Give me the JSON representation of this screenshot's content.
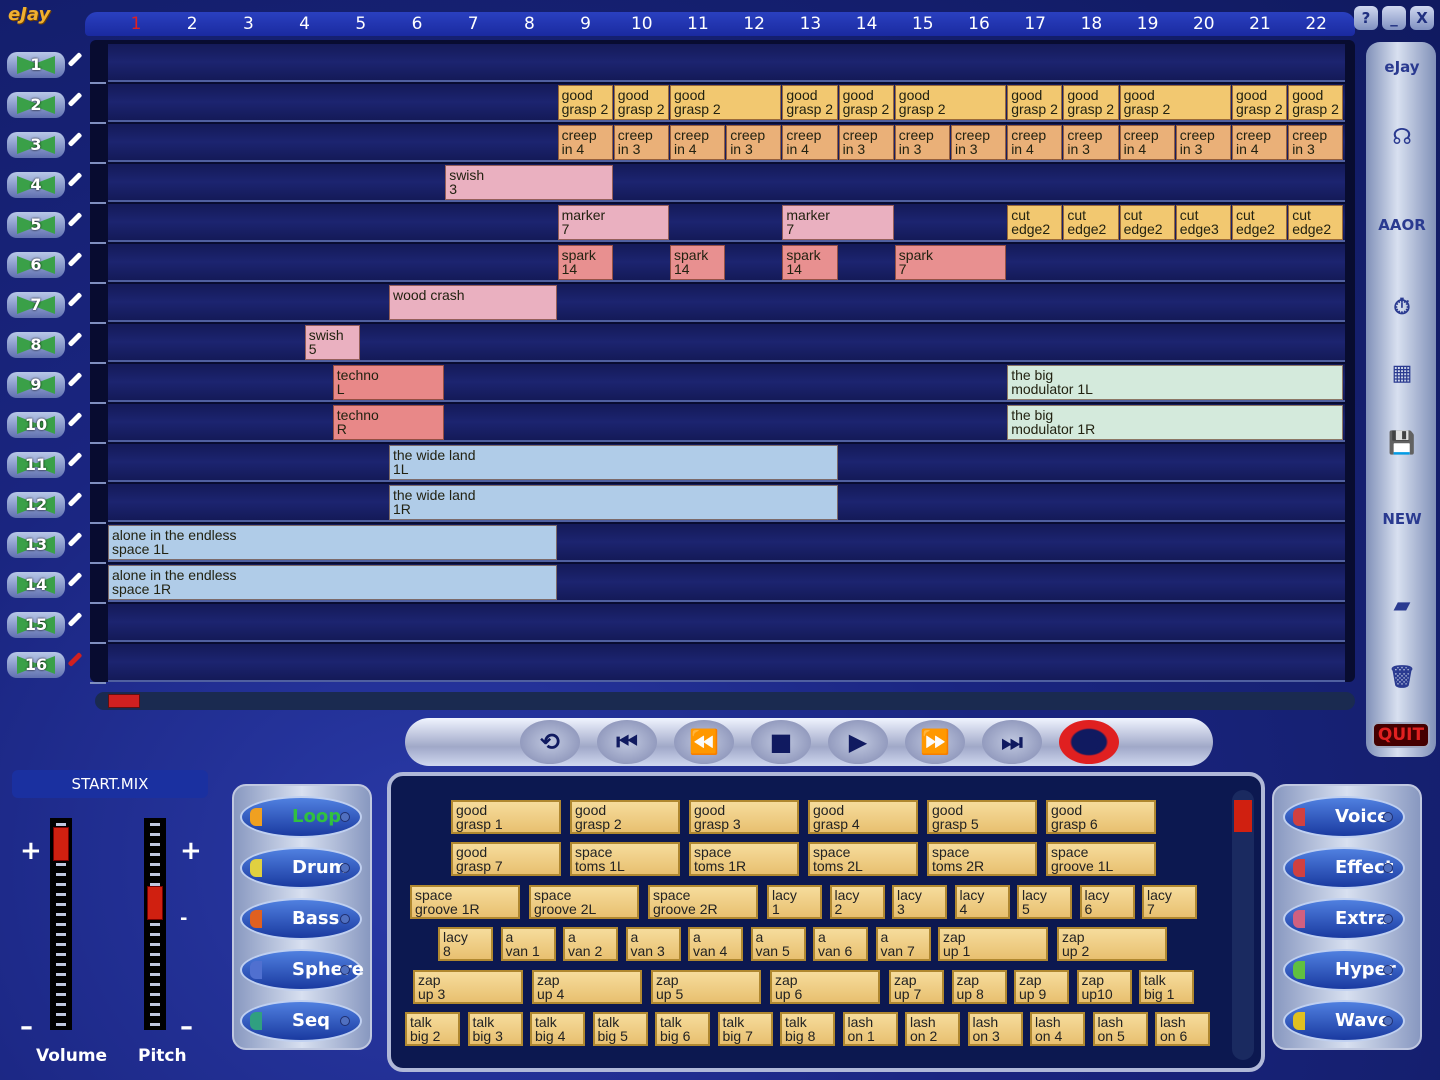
{
  "app": {
    "logo": "eJay"
  },
  "window_buttons": [
    "?",
    "_",
    "X"
  ],
  "ruler": {
    "bars": [
      "1",
      "2",
      "3",
      "4",
      "5",
      "6",
      "7",
      "8",
      "9",
      "10",
      "11",
      "12",
      "13",
      "14",
      "15",
      "16",
      "17",
      "18",
      "19",
      "20",
      "21",
      "22"
    ],
    "current_bar": "1",
    "current_color": "#e02020"
  },
  "tracks": [
    "1",
    "2",
    "3",
    "4",
    "5",
    "6",
    "7",
    "8",
    "9",
    "10",
    "11",
    "12",
    "13",
    "14",
    "15",
    "16"
  ],
  "active_track": "16",
  "clips": [
    {
      "track": 2,
      "start": 9,
      "length": 1,
      "label": "good\ngrasp 2",
      "color": "#f2c870"
    },
    {
      "track": 2,
      "start": 10,
      "length": 1,
      "label": "good\ngrasp 2",
      "color": "#f2c870"
    },
    {
      "track": 2,
      "start": 11,
      "length": 2,
      "label": "good\ngrasp 2",
      "color": "#f2c870"
    },
    {
      "track": 2,
      "start": 13,
      "length": 1,
      "label": "good\ngrasp 2",
      "color": "#f2c870"
    },
    {
      "track": 2,
      "start": 14,
      "length": 1,
      "label": "good\ngrasp 2",
      "color": "#f2c870"
    },
    {
      "track": 2,
      "start": 15,
      "length": 2,
      "label": "good\ngrasp 2",
      "color": "#f2c870"
    },
    {
      "track": 2,
      "start": 17,
      "length": 1,
      "label": "good\ngrasp 2",
      "color": "#f2c870"
    },
    {
      "track": 2,
      "start": 18,
      "length": 1,
      "label": "good\ngrasp 2",
      "color": "#f2c870"
    },
    {
      "track": 2,
      "start": 19,
      "length": 2,
      "label": "good\ngrasp 2",
      "color": "#f2c870"
    },
    {
      "track": 2,
      "start": 21,
      "length": 1,
      "label": "good\ngrasp 2",
      "color": "#f2c870"
    },
    {
      "track": 2,
      "start": 22,
      "length": 1,
      "label": "good\ngrasp 2",
      "color": "#f2c870"
    },
    {
      "track": 3,
      "start": 9,
      "length": 1,
      "label": "creep\nin 4",
      "color": "#eab078"
    },
    {
      "track": 3,
      "start": 10,
      "length": 1,
      "label": "creep\nin 3",
      "color": "#eab078"
    },
    {
      "track": 3,
      "start": 11,
      "length": 1,
      "label": "creep\nin 4",
      "color": "#eab078"
    },
    {
      "track": 3,
      "start": 12,
      "length": 1,
      "label": "creep\nin 3",
      "color": "#eab078"
    },
    {
      "track": 3,
      "start": 13,
      "length": 1,
      "label": "creep\nin 4",
      "color": "#eab078"
    },
    {
      "track": 3,
      "start": 14,
      "length": 1,
      "label": "creep\nin 3",
      "color": "#eab078"
    },
    {
      "track": 3,
      "start": 15,
      "length": 1,
      "label": "creep\nin 3",
      "color": "#eab078"
    },
    {
      "track": 3,
      "start": 16,
      "length": 1,
      "label": "creep\nin 3",
      "color": "#eab078"
    },
    {
      "track": 3,
      "start": 17,
      "length": 1,
      "label": "creep\nin 4",
      "color": "#eab078"
    },
    {
      "track": 3,
      "start": 18,
      "length": 1,
      "label": "creep\nin 3",
      "color": "#eab078"
    },
    {
      "track": 3,
      "start": 19,
      "length": 1,
      "label": "creep\nin 4",
      "color": "#eab078"
    },
    {
      "track": 3,
      "start": 20,
      "length": 1,
      "label": "creep\nin 3",
      "color": "#eab078"
    },
    {
      "track": 3,
      "start": 21,
      "length": 1,
      "label": "creep\nin 4",
      "color": "#eab078"
    },
    {
      "track": 3,
      "start": 22,
      "length": 1,
      "label": "creep\nin 3",
      "color": "#eab078"
    },
    {
      "track": 4,
      "start": 7,
      "length": 3,
      "label": "swish\n3",
      "color": "#eab0c0"
    },
    {
      "track": 5,
      "start": 9,
      "length": 2,
      "label": "marker\n7",
      "color": "#eab0c0"
    },
    {
      "track": 5,
      "start": 13,
      "length": 2,
      "label": "marker\n7",
      "color": "#eab0c0"
    },
    {
      "track": 5,
      "start": 17,
      "length": 1,
      "label": "cut\nedge2",
      "color": "#f2c870"
    },
    {
      "track": 5,
      "start": 18,
      "length": 1,
      "label": "cut\nedge2",
      "color": "#f2c870"
    },
    {
      "track": 5,
      "start": 19,
      "length": 1,
      "label": "cut\nedge2",
      "color": "#f2c870"
    },
    {
      "track": 5,
      "start": 20,
      "length": 1,
      "label": "cut\nedge3",
      "color": "#f2c870"
    },
    {
      "track": 5,
      "start": 21,
      "length": 1,
      "label": "cut\nedge2",
      "color": "#f2c870"
    },
    {
      "track": 5,
      "start": 22,
      "length": 1,
      "label": "cut\nedge2",
      "color": "#f2c870"
    },
    {
      "track": 6,
      "start": 9,
      "length": 1,
      "label": "spark\n14",
      "color": "#e89090"
    },
    {
      "track": 6,
      "start": 11,
      "length": 1,
      "label": "spark\n14",
      "color": "#e89090"
    },
    {
      "track": 6,
      "start": 13,
      "length": 1,
      "label": "spark\n14",
      "color": "#e89090"
    },
    {
      "track": 6,
      "start": 15,
      "length": 2,
      "label": "spark\n7",
      "color": "#e89090"
    },
    {
      "track": 7,
      "start": 6,
      "length": 3,
      "label": "wood crash",
      "color": "#eab0c0"
    },
    {
      "track": 8,
      "start": 4.5,
      "length": 1,
      "label": "swish\n5",
      "color": "#eab0c0"
    },
    {
      "track": 9,
      "start": 5,
      "length": 2,
      "label": "techno\nL",
      "color": "#e88888"
    },
    {
      "track": 9,
      "start": 17,
      "length": 6,
      "label": "the big\nmodulator 1L",
      "color": "#d4eadc"
    },
    {
      "track": 10,
      "start": 5,
      "length": 2,
      "label": "techno\nR",
      "color": "#e88888"
    },
    {
      "track": 10,
      "start": 17,
      "length": 6,
      "label": "the big\nmodulator 1R",
      "color": "#d4eadc"
    },
    {
      "track": 11,
      "start": 6,
      "length": 8,
      "label": "the wide land\n1L",
      "color": "#b0cce8"
    },
    {
      "track": 12,
      "start": 6,
      "length": 8,
      "label": "the wide land\n1R",
      "color": "#b0cce8"
    },
    {
      "track": 13,
      "start": 1,
      "length": 8,
      "label": "alone in the endless\nspace 1L",
      "color": "#b0cce8"
    },
    {
      "track": 14,
      "start": 1,
      "length": 8,
      "label": "alone in the endless\nspace 1R",
      "color": "#b0cce8"
    }
  ],
  "tools": [
    {
      "name": "ejay-logo",
      "glyph": "eJay"
    },
    {
      "name": "mixer-face",
      "glyph": "☊"
    },
    {
      "name": "effects-burst",
      "glyph": "AAOR"
    },
    {
      "name": "stopwatch",
      "glyph": "⏱"
    },
    {
      "name": "keyboard",
      "glyph": "▦"
    },
    {
      "name": "save",
      "glyph": "💾"
    },
    {
      "name": "new",
      "glyph": "NEW"
    },
    {
      "name": "eraser",
      "glyph": "▰"
    },
    {
      "name": "trash",
      "glyph": "🗑"
    }
  ],
  "quit_label": "QUIT",
  "transport": [
    "⟲",
    "⏮",
    "⏪",
    "■",
    "▶",
    "⏩",
    "⏭",
    "●"
  ],
  "mix_name": "START.MIX",
  "volume": {
    "label": "Volume",
    "plus": "+",
    "minus": "–",
    "level": 0.95
  },
  "pitch": {
    "label": "Pitch",
    "plus": "+",
    "minus": "–",
    "mid": "-",
    "level": 0.62
  },
  "categories_left": [
    {
      "label": "Loop",
      "stripe": "#f0a020",
      "active": true
    },
    {
      "label": "Drum",
      "stripe": "#e0d040"
    },
    {
      "label": "Bass",
      "stripe": "#e06020"
    },
    {
      "label": "Sphere",
      "stripe": "#5070d0"
    },
    {
      "label": "Seq",
      "stripe": "#30a080"
    }
  ],
  "categories_right": [
    {
      "label": "Voice",
      "stripe": "#d04040"
    },
    {
      "label": "Effect",
      "stripe": "#d04040"
    },
    {
      "label": "Extra",
      "stripe": "#d06080"
    },
    {
      "label": "Hyper",
      "stripe": "#60c040"
    },
    {
      "label": "Wave",
      "stripe": "#e0c020"
    }
  ],
  "library": [
    [
      {
        "l": "good\ngrasp 1",
        "len": 2
      },
      {
        "l": "good\ngrasp 2",
        "len": 2
      },
      {
        "l": "good\ngrasp 3",
        "len": 2
      },
      {
        "l": "good\ngrasp 4",
        "len": 2
      },
      {
        "l": "good\ngrasp 5",
        "len": 2
      },
      {
        "l": "good\ngrasp 6",
        "len": 2
      }
    ],
    [
      {
        "l": "good\ngrasp 7",
        "len": 2
      },
      {
        "l": "space\ntoms 1L",
        "len": 2
      },
      {
        "l": "space\ntoms 1R",
        "len": 2
      },
      {
        "l": "space\ntoms 2L",
        "len": 2
      },
      {
        "l": "space\ntoms 2R",
        "len": 2
      },
      {
        "l": "space\ngroove 1L",
        "len": 2
      }
    ],
    [
      {
        "l": "space\ngroove 1R",
        "len": 2
      },
      {
        "l": "space\ngroove 2L",
        "len": 2
      },
      {
        "l": "space\ngroove 2R",
        "len": 2
      },
      {
        "l": "lacy\n1",
        "len": 1
      },
      {
        "l": "lacy\n2",
        "len": 1
      },
      {
        "l": "lacy\n3",
        "len": 1
      },
      {
        "l": "lacy\n4",
        "len": 1
      },
      {
        "l": "lacy\n5",
        "len": 1
      },
      {
        "l": "lacy\n6",
        "len": 1
      },
      {
        "l": "lacy\n7",
        "len": 1
      }
    ],
    [
      {
        "l": "lacy\n8",
        "len": 1
      },
      {
        "l": "a\nvan 1",
        "len": 1
      },
      {
        "l": "a\nvan 2",
        "len": 1
      },
      {
        "l": "a\nvan 3",
        "len": 1
      },
      {
        "l": "a\nvan 4",
        "len": 1
      },
      {
        "l": "a\nvan 5",
        "len": 1
      },
      {
        "l": "a\nvan 6",
        "len": 1
      },
      {
        "l": "a\nvan 7",
        "len": 1
      },
      {
        "l": "zap\nup 1",
        "len": 2
      },
      {
        "l": "zap\nup 2",
        "len": 2
      }
    ],
    [
      {
        "l": "zap\nup 3",
        "len": 2
      },
      {
        "l": "zap\nup 4",
        "len": 2
      },
      {
        "l": "zap\nup 5",
        "len": 2
      },
      {
        "l": "zap\nup 6",
        "len": 2
      },
      {
        "l": "zap\nup 7",
        "len": 1
      },
      {
        "l": "zap\nup 8",
        "len": 1
      },
      {
        "l": "zap\nup 9",
        "len": 1
      },
      {
        "l": "zap\nup10",
        "len": 1
      },
      {
        "l": "talk\nbig 1",
        "len": 1
      }
    ],
    [
      {
        "l": "talk\nbig 2",
        "len": 1
      },
      {
        "l": "talk\nbig 3",
        "len": 1
      },
      {
        "l": "talk\nbig 4",
        "len": 1
      },
      {
        "l": "talk\nbig 5",
        "len": 1
      },
      {
        "l": "talk\nbig 6",
        "len": 1
      },
      {
        "l": "talk\nbig 7",
        "len": 1
      },
      {
        "l": "talk\nbig 8",
        "len": 1
      },
      {
        "l": "lash\non 1",
        "len": 1
      },
      {
        "l": "lash\non 2",
        "len": 1
      },
      {
        "l": "lash\non 3",
        "len": 1
      },
      {
        "l": "lash\non 4",
        "len": 1
      },
      {
        "l": "lash\non 5",
        "len": 1
      },
      {
        "l": "lash\non 6",
        "len": 1
      }
    ]
  ]
}
